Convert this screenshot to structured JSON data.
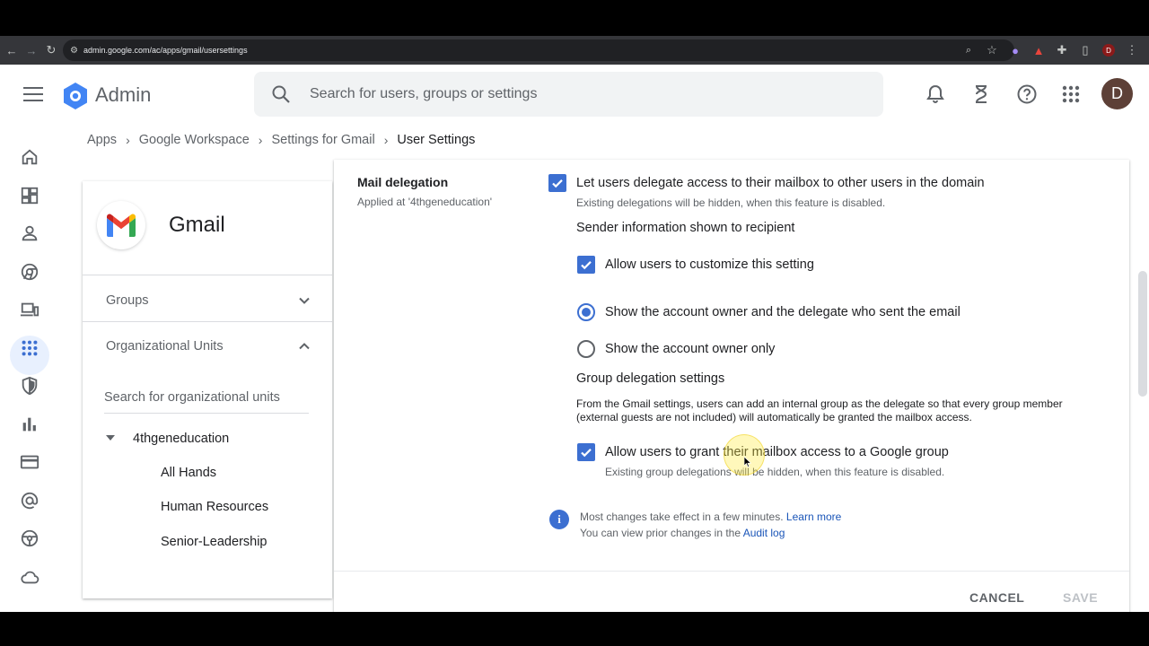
{
  "browser": {
    "url": "admin.google.com/ac/apps/gmail/usersettings",
    "profile_initial": "D"
  },
  "header": {
    "app_name": "Admin",
    "search_placeholder": "Search for users, groups or settings",
    "avatar_initial": "D"
  },
  "breadcrumb": {
    "items": [
      "Apps",
      "Google Workspace",
      "Settings for Gmail"
    ],
    "current": "User Settings"
  },
  "left_panel": {
    "app_title": "Gmail",
    "groups_label": "Groups",
    "ou_label": "Organizational Units",
    "ou_search_placeholder": "Search for organizational units",
    "ou_root": "4thgeneducation",
    "ou_children": [
      "All Hands",
      "Human Resources",
      "Senior-Leadership"
    ]
  },
  "setting": {
    "title": "Mail delegation",
    "applied_at": "Applied at '4thgeneducation'",
    "delegate_label": "Let users delegate access to their mailbox to other users in the domain",
    "delegate_note": "Existing delegations will be hidden, when this feature is disabled.",
    "sender_info_heading": "Sender information shown to recipient",
    "customize_label": "Allow users to customize this setting",
    "radio_owner_and_delegate": "Show the account owner and the delegate who sent the email",
    "radio_owner_only": "Show the account owner only",
    "group_heading": "Group delegation settings",
    "group_desc": "From the Gmail settings, users can add an internal group as the delegate so that every group member (external guests are not included) will automatically be granted the mailbox access.",
    "group_label": "Allow users to grant their mailbox access to a Google group",
    "group_note": "Existing group delegations will be hidden, when this feature is disabled.",
    "info_line1": "Most changes take effect in a few minutes.",
    "learn_more": "Learn more",
    "info_line2": "You can view prior changes in the",
    "audit_log": "Audit log"
  },
  "footer": {
    "cancel": "CANCEL",
    "save": "SAVE"
  },
  "colors": {
    "accent": "#3c6fd1",
    "link": "#1a55b8",
    "avatar": "#5d4037"
  }
}
